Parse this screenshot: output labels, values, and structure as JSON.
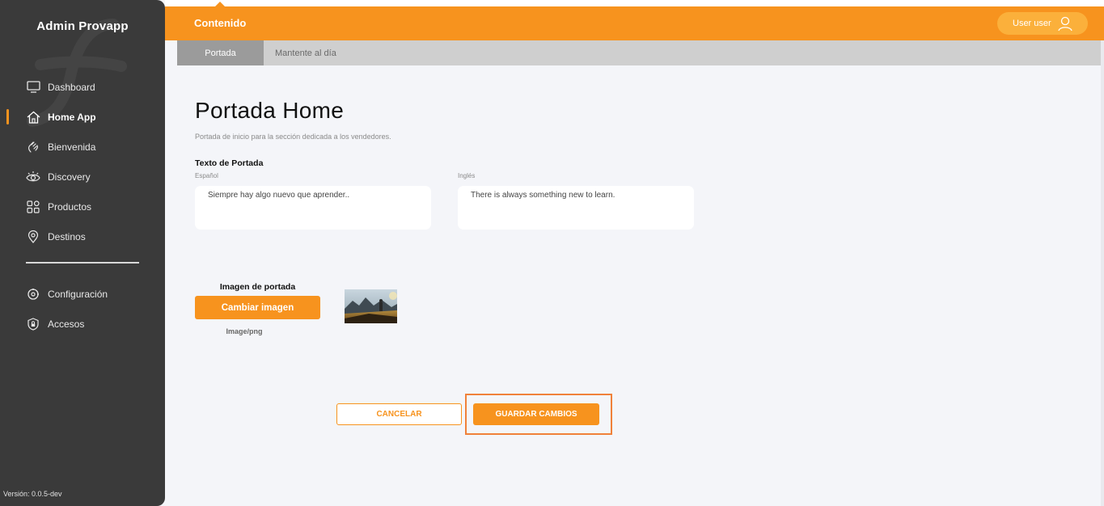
{
  "sidebar": {
    "brand": "Admin Provapp",
    "items": [
      {
        "label": "Dashboard",
        "icon": "monitor-icon"
      },
      {
        "label": "Home App",
        "icon": "home-icon",
        "active": true
      },
      {
        "label": "Bienvenida",
        "icon": "wave-hand-icon"
      },
      {
        "label": "Discovery",
        "icon": "eye-icon"
      },
      {
        "label": "Productos",
        "icon": "grid-icon"
      },
      {
        "label": "Destinos",
        "icon": "location-pin-icon"
      }
    ],
    "settings_items": [
      {
        "label": "Configuración",
        "icon": "gear-icon"
      },
      {
        "label": "Accesos",
        "icon": "shield-lock-icon"
      }
    ],
    "version": "Versión: 0.0.5-dev"
  },
  "header": {
    "title": "Contenido",
    "user_label": "User user"
  },
  "tabs": [
    {
      "label": "Portada",
      "active": true
    },
    {
      "label": "Mantente al día",
      "active": false
    }
  ],
  "main": {
    "title": "Portada Home",
    "subtitle": "Portada de inicio para la sección dedicada a los vendedores.",
    "section_label": "Texto de Portada",
    "spanish_label": "Español",
    "spanish_value": "Siempre hay algo nuevo que aprender..",
    "english_label": "Inglés",
    "english_value": "There is always something new to learn.",
    "image_label": "Imagen de portada",
    "change_image_label": "Cambiar imagen",
    "image_type": "Image/png",
    "cancel_label": "CANCELAR",
    "save_label": "GUARDAR CAMBIOS"
  },
  "colors": {
    "accent": "#f7931e",
    "sidebar_bg": "#3a3a3a",
    "page_bg": "#f4f5f9"
  }
}
